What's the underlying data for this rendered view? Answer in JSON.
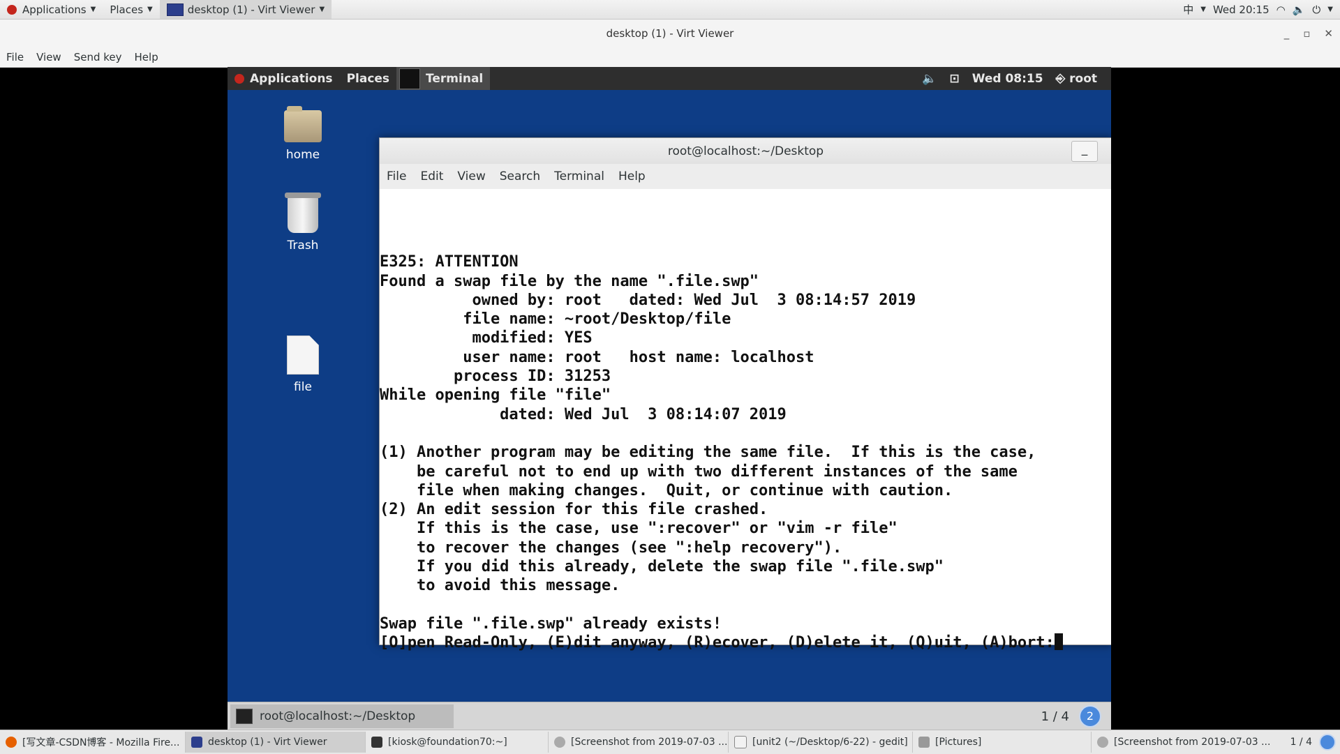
{
  "host_panel": {
    "applications": "Applications",
    "places": "Places",
    "active_window": "desktop (1) - Virt Viewer",
    "input_method": "中",
    "clock": "Wed 20:15"
  },
  "viewer": {
    "title": "desktop (1) - Virt Viewer",
    "menu": [
      "File",
      "View",
      "Send key",
      "Help"
    ]
  },
  "guest_panel": {
    "applications": "Applications",
    "places": "Places",
    "terminal": "Terminal",
    "clock": "Wed 08:15",
    "user": "root"
  },
  "desktop_icons": [
    "home",
    "Trash",
    "file"
  ],
  "terminal": {
    "title": "root@localhost:~/Desktop",
    "menu": [
      "File",
      "Edit",
      "View",
      "Search",
      "Terminal",
      "Help"
    ],
    "lines": [
      "E325: ATTENTION",
      "Found a swap file by the name \".file.swp\"",
      "          owned by: root   dated: Wed Jul  3 08:14:57 2019",
      "         file name: ~root/Desktop/file",
      "          modified: YES",
      "         user name: root   host name: localhost",
      "        process ID: 31253",
      "While opening file \"file\"",
      "             dated: Wed Jul  3 08:14:07 2019",
      "",
      "(1) Another program may be editing the same file.  If this is the case,",
      "    be careful not to end up with two different instances of the same",
      "    file when making changes.  Quit, or continue with caution.",
      "(2) An edit session for this file crashed.",
      "    If this is the case, use \":recover\" or \"vim -r file\"",
      "    to recover the changes (see \":help recovery\").",
      "    If you did this already, delete the swap file \".file.swp\"",
      "    to avoid this message.",
      "",
      "Swap file \".file.swp\" already exists!"
    ],
    "prompt": "[O]pen Read-Only, (E)dit anyway, (R)ecover, (D)elete it, (Q)uit, (A)bort:"
  },
  "guest_bottom": {
    "task": "root@localhost:~/Desktop",
    "workspace": "1 / 4",
    "badge": "2"
  },
  "host_taskbar": {
    "items": [
      "[写文章-CSDN博客 - Mozilla Fire...",
      "desktop (1) - Virt Viewer",
      "[kiosk@foundation70:~]",
      "[Screenshot from 2019-07-03 ...",
      "[unit2 (~/Desktop/6-22) - gedit]",
      "[Pictures]",
      "[Screenshot from 2019-07-03 ..."
    ],
    "workspace": "1 / 4"
  }
}
